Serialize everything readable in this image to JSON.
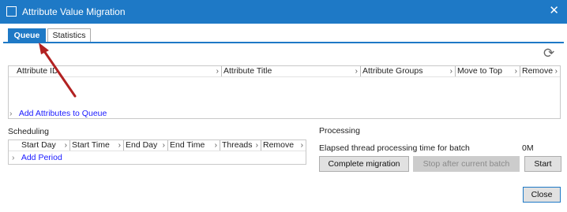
{
  "window": {
    "title": "Attribute Value Migration",
    "close_glyph": "✕",
    "accent_color": "#1e79c6"
  },
  "tabs": [
    {
      "label": "Queue",
      "active": true
    },
    {
      "label": "Statistics",
      "active": false
    }
  ],
  "queue": {
    "refresh_icon": "refresh-icon",
    "columns": [
      "Attribute ID",
      "Attribute Title",
      "Attribute Groups",
      "Move to Top",
      "Remove"
    ],
    "add_link": "Add Attributes to Queue"
  },
  "scheduling": {
    "heading": "Scheduling",
    "columns": [
      "Start Day",
      "Start Time",
      "End Day",
      "End Time",
      "Threads",
      "Remove"
    ],
    "add_link": "Add Period"
  },
  "processing": {
    "heading": "Processing",
    "elapsed_label": "Elapsed thread processing time for batch",
    "elapsed_value": "0M",
    "complete_button": "Complete migration",
    "stop_button": "Stop after current batch",
    "start_button": "Start"
  },
  "footer": {
    "close_button": "Close"
  },
  "annotation": {
    "color": "#b22222"
  }
}
